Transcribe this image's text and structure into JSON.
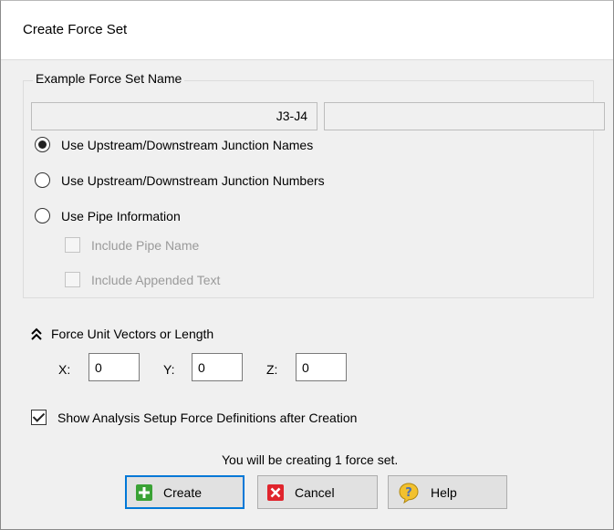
{
  "window": {
    "title": "Create Force Set"
  },
  "name_group": {
    "legend": "Example Force Set Name",
    "preview_value": "J3-J4",
    "appended_value": "",
    "options": [
      {
        "label": "Use Upstream/Downstream Junction Names",
        "checked": true
      },
      {
        "label": "Use Upstream/Downstream Junction Numbers",
        "checked": false
      },
      {
        "label": "Use Pipe Information",
        "checked": false
      }
    ],
    "sub_options": [
      {
        "label": "Include Pipe Name",
        "checked": false,
        "enabled": false
      },
      {
        "label": "Include Appended Text",
        "checked": false,
        "enabled": false
      }
    ]
  },
  "vectors": {
    "title": "Force Unit Vectors or Length",
    "x_label": "X:",
    "x_value": "0",
    "y_label": "Y:",
    "y_value": "0",
    "z_label": "Z:",
    "z_value": "0"
  },
  "show_definitions": {
    "label": "Show Analysis Setup Force Definitions after Creation",
    "checked": true
  },
  "info_text": "You will be creating 1 force set.",
  "buttons": {
    "create": "Create",
    "cancel": "Cancel",
    "help": "Help"
  },
  "colors": {
    "create_icon": "#3aa235",
    "cancel_icon": "#e0242c",
    "help_icon": "#f2c12e"
  }
}
